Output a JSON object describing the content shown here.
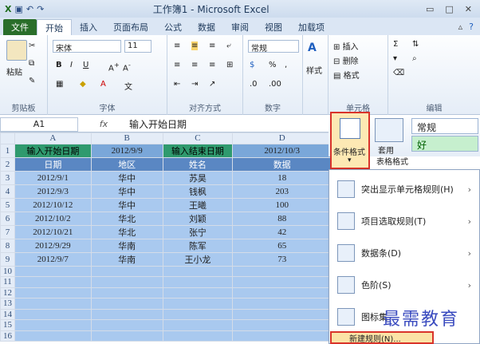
{
  "window": {
    "title": "工作簿1 - Microsoft Excel"
  },
  "tabs": [
    "文件",
    "开始",
    "插入",
    "页面布局",
    "公式",
    "数据",
    "审阅",
    "视图",
    "加载项"
  ],
  "ribbon": {
    "clipboard": {
      "label": "剪贴板",
      "paste": "粘贴"
    },
    "font": {
      "label": "字体",
      "name": "宋体",
      "size": "11"
    },
    "alignment": {
      "label": "对齐方式"
    },
    "number": {
      "label": "数字",
      "format": "常规"
    },
    "styles": {
      "label": "样式"
    },
    "cells": {
      "label": "单元格",
      "insert": "插入",
      "delete": "删除",
      "format": "格式"
    },
    "editing": {
      "label": "编辑"
    }
  },
  "formula": {
    "cell": "A1",
    "fx": "fx",
    "value": "输入开始日期"
  },
  "columns": [
    "",
    "A",
    "B",
    "C",
    "D"
  ],
  "rows": [
    {
      "n": "1",
      "cells": [
        "输入开始日期",
        "2012/9/9",
        "输入结束日期",
        "2012/10/3"
      ]
    },
    {
      "n": "2",
      "cells": [
        "日期",
        "地区",
        "姓名",
        "数据"
      ]
    },
    {
      "n": "3",
      "cells": [
        "2012/9/1",
        "华中",
        "苏昊",
        "18"
      ]
    },
    {
      "n": "4",
      "cells": [
        "2012/9/3",
        "华中",
        "钱枫",
        "203"
      ]
    },
    {
      "n": "5",
      "cells": [
        "2012/10/12",
        "华中",
        "王曦",
        "100"
      ]
    },
    {
      "n": "6",
      "cells": [
        "2012/10/2",
        "华北",
        "刘颖",
        "88"
      ]
    },
    {
      "n": "7",
      "cells": [
        "2012/10/21",
        "华北",
        "张宁",
        "42"
      ]
    },
    {
      "n": "8",
      "cells": [
        "2012/9/29",
        "华南",
        "陈军",
        "65"
      ]
    },
    {
      "n": "9",
      "cells": [
        "2012/9/7",
        "华南",
        "王小龙",
        "73"
      ]
    },
    {
      "n": "10",
      "cells": [
        "",
        "",
        "",
        ""
      ]
    },
    {
      "n": "11",
      "cells": [
        "",
        "",
        "",
        ""
      ]
    },
    {
      "n": "12",
      "cells": [
        "",
        "",
        "",
        ""
      ]
    },
    {
      "n": "13",
      "cells": [
        "",
        "",
        "",
        ""
      ]
    },
    {
      "n": "14",
      "cells": [
        "",
        "",
        "",
        ""
      ]
    },
    {
      "n": "15",
      "cells": [
        "",
        "",
        "",
        ""
      ]
    },
    {
      "n": "16",
      "cells": [
        "",
        "",
        "",
        ""
      ]
    }
  ],
  "cf": {
    "button": "条件格式",
    "table": "套用",
    "table2": "表格格式",
    "style1": "常规",
    "style2": "好"
  },
  "menu": [
    {
      "label": "突出显示单元格规则(H)"
    },
    {
      "label": "项目选取规则(T)"
    },
    {
      "label": "数据条(D)"
    },
    {
      "label": "色阶(S)"
    },
    {
      "label": "图标集"
    }
  ],
  "newrule": "新建规则(N)...",
  "watermark": "最需教育"
}
